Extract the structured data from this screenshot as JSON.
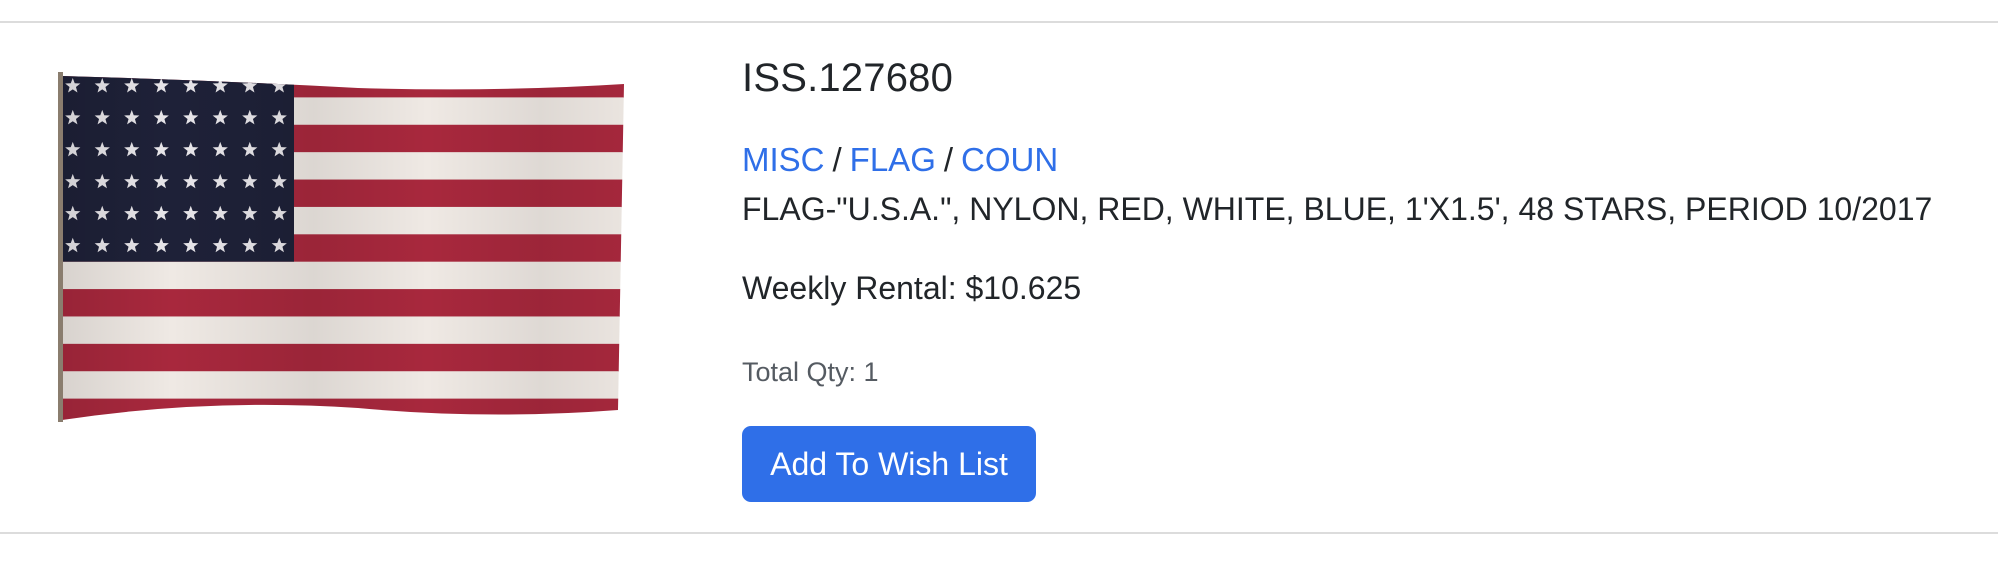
{
  "product": {
    "image_alt": "48-star American flag",
    "item_id": "ISS.127680",
    "breadcrumb": {
      "items": [
        "MISC",
        "FLAG",
        "COUN"
      ],
      "separator": "/"
    },
    "description": "FLAG-\"U.S.A.\", NYLON, RED, WHITE, BLUE, 1'X1.5', 48 STARS, PERIOD 10/2017",
    "weekly_rental": "Weekly Rental: $10.625",
    "total_qty": "Total Qty: 1",
    "wish_list_label": "Add To Wish List"
  },
  "colors": {
    "link": "#2f6fe8",
    "button_bg": "#2f6fe8",
    "flag_red": "#a8283d",
    "flag_white": "#efe9e4",
    "flag_blue": "#1e2138"
  },
  "flag": {
    "stars_rows": 6,
    "stars_cols": 8,
    "stripes": 13
  }
}
